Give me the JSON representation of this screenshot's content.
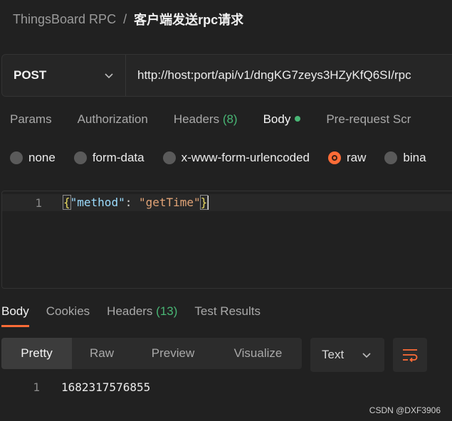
{
  "breadcrumb": {
    "parent": "ThingsBoard RPC",
    "separator": "/",
    "current": "客户端发送rpc请求"
  },
  "request": {
    "method": "POST",
    "url": "http://host:port/api/v1/dngKG7zeys3HZyKfQ6SI/rpc"
  },
  "request_tabs": [
    {
      "label": "Params"
    },
    {
      "label": "Authorization"
    },
    {
      "label": "Headers",
      "count": "(8)"
    },
    {
      "label": "Body",
      "active": true
    },
    {
      "label": "Pre-request Scr"
    }
  ],
  "body_types": [
    {
      "label": "none",
      "checked": false
    },
    {
      "label": "form-data",
      "checked": false
    },
    {
      "label": "x-www-form-urlencoded",
      "checked": false
    },
    {
      "label": "raw",
      "checked": true
    },
    {
      "label": "bina",
      "checked": false
    }
  ],
  "editor": {
    "line_number": "1",
    "brace_open": "{",
    "key": "\"method\"",
    "colon": ": ",
    "value": "\"getTime\"",
    "brace_close": "}"
  },
  "response_tabs": [
    {
      "label": "Body",
      "active": true
    },
    {
      "label": "Cookies"
    },
    {
      "label": "Headers",
      "count": "(13)"
    },
    {
      "label": "Test Results"
    }
  ],
  "view_modes": [
    {
      "label": "Pretty",
      "active": true
    },
    {
      "label": "Raw"
    },
    {
      "label": "Preview"
    },
    {
      "label": "Visualize"
    }
  ],
  "format_select": {
    "value": "Text"
  },
  "response_body": {
    "line_number": "1",
    "value": "1682317576855"
  },
  "watermark": "CSDN @DXF3906",
  "colors": {
    "accent": "#ff6c37",
    "success": "#49b675"
  }
}
